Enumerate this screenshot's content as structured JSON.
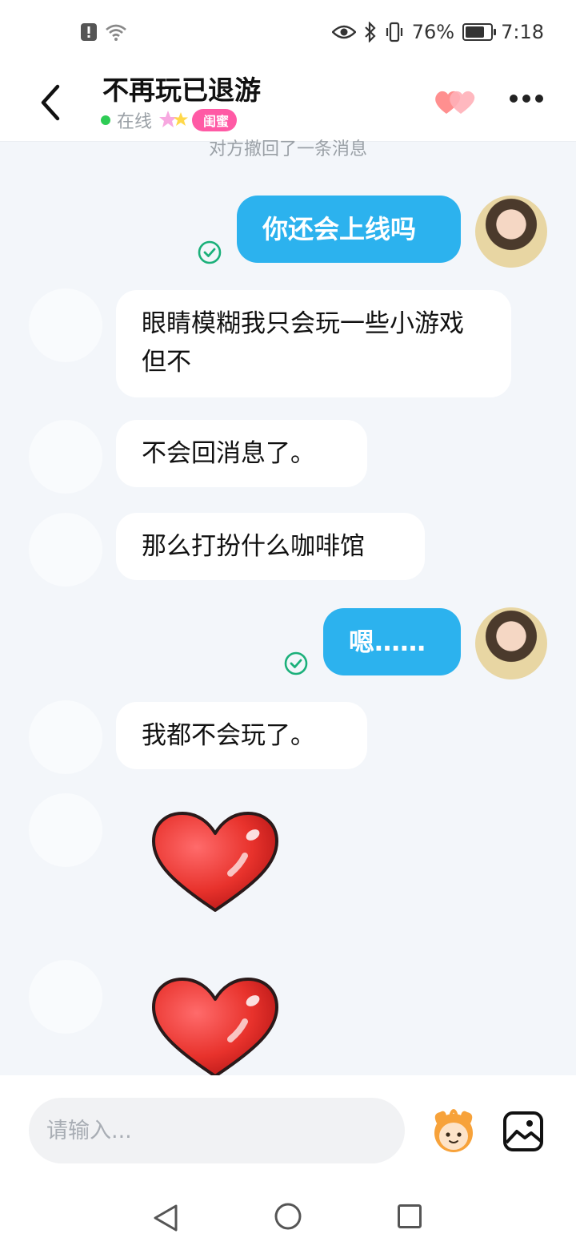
{
  "status_bar": {
    "battery": "76%",
    "battery_fraction": 0.76,
    "time": "7:18",
    "icons": [
      "alert-icon",
      "wifi-icon",
      "eye-icon",
      "bluetooth-icon",
      "vibrate-icon",
      "battery-icon"
    ]
  },
  "header": {
    "title": "不再玩已退游",
    "status": "在线",
    "badge": "闺蜜",
    "icons": [
      "back-arrow-icon",
      "double-heart-icon",
      "more-dots-icon"
    ]
  },
  "notice": "对方撤回了一条消息",
  "messages": [
    {
      "from": "me",
      "text": "你还会上线吗"
    },
    {
      "from": "them",
      "text": "眼睛模糊我只会玩一些小游戏但不"
    },
    {
      "from": "them",
      "text": "不会回消息了。"
    },
    {
      "from": "them",
      "text": "那么打扮什么咖啡馆"
    },
    {
      "from": "me",
      "text": "嗯……"
    },
    {
      "from": "them",
      "text": "我都不会玩了。"
    },
    {
      "from": "them",
      "sticker": "heart-sticker"
    },
    {
      "from": "them",
      "sticker": "heart-sticker"
    }
  ],
  "input": {
    "placeholder": "请输入..."
  },
  "colors": {
    "accent": "#2cb2ee",
    "badge": "#ff5aa5",
    "online": "#2ecc55",
    "read_check": "#1bb07a",
    "background": "#f3f6fa"
  }
}
